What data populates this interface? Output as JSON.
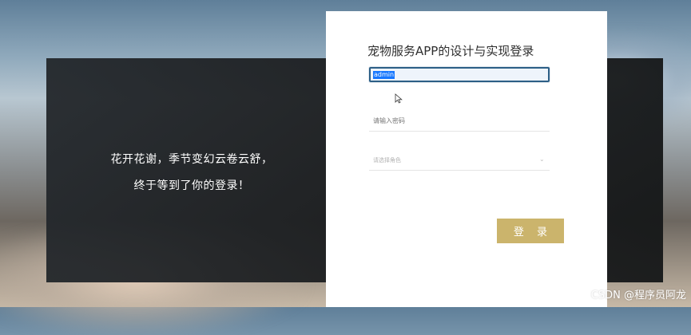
{
  "background": {
    "accent_color": "#1c1e20",
    "button_color": "#cbb46c"
  },
  "slogan": {
    "line1": "花开花谢，季节变幻云卷云舒，",
    "line2": "终于等到了你的登录！"
  },
  "login": {
    "title": "宠物服务APP的设计与实现登录",
    "username_value": "admin",
    "password_placeholder": "请输入密码",
    "role_placeholder": "请选择角色",
    "login_label": "登 录",
    "chevron_icon": "chevron-down-icon"
  },
  "watermark": "CSDN @程序员阿龙"
}
